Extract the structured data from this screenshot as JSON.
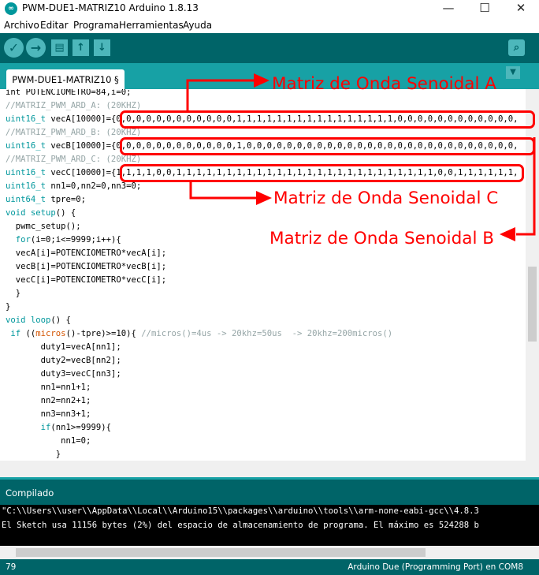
{
  "window": {
    "title": "PWM-DUE1-MATRIZ10 Arduino 1.8.13",
    "app_icon": "∞",
    "minimize": "—",
    "maximize": "☐",
    "close": "✕"
  },
  "menu": {
    "items": [
      "Archivo",
      "Editar",
      "Programa",
      "Herramientas",
      "Ayuda"
    ]
  },
  "toolbar": {
    "verify_icon": "✓",
    "upload_icon": "→",
    "new_icon": "▤",
    "open_icon": "↑",
    "save_icon": "↓",
    "serial_monitor_icon": "⌕"
  },
  "tab": {
    "label": "PWM-DUE1-MATRIZ10 §",
    "menu_icon": "▼"
  },
  "code": {
    "line1": "int POTENCIOMETRO=84,i=0;",
    "line2": "//MATRIZ_PWM_ARD_A: (20KHZ)",
    "line3a": "uint16_t",
    "line3b": " vecA[10000]={0,0,0,0,0,0,0,0,0,0,0,0,1,1,1,1,1,1,1,1,1,1,1,1,1,1,1,1,0,0,0,0,0,0,0,0,0,0,0,0,",
    "line4": "//MATRIZ_PWM_ARD_B: (20KHZ)",
    "line5a": "uint16_t",
    "line5b": " vecB[10000]={0,0,0,0,0,0,0,0,0,0,0,0,1,0,0,0,0,0,0,0,0,0,0,0,0,0,0,0,0,0,0,0,0,0,0,0,0,0,0,0,",
    "line6": "//MATRIZ_PWM_ARD_C: (20KHZ)",
    "line7a": "uint16_t",
    "line7b": " vecC[10000]={1,1,1,1,0,0,1,1,1,1,1,1,1,1,1,1,1,1,1,1,1,1,1,1,1,1,1,1,1,1,1,1,0,0,1,1,1,1,1,1,",
    "line8a": "uint16_t",
    "line8b": " nn1=0,nn2=0,nn3=0;",
    "line9a": "uint64_t",
    "line9b": " tpre=0;",
    "line10a": "void",
    "line10b": " ",
    "line10c": "setup",
    "line10d": "() {",
    "line11": "  pwmc_setup();",
    "line12a": "  ",
    "line12b": "for",
    "line12c": "(i=0;i<=9999;i++){",
    "line13": "  vecA[i]=POTENCIOMETRO*vecA[i];",
    "line14": "  vecB[i]=POTENCIOMETRO*vecB[i];",
    "line15": "  vecC[i]=POTENCIOMETRO*vecC[i];",
    "line16": "  }",
    "line17": "}",
    "line18a": "void",
    "line18b": " ",
    "line18c": "loop",
    "line18d": "() {",
    "line19a": " ",
    "line19b": "if",
    "line19c": " ((",
    "line19d": "micros",
    "line19e": "()-tpre)>=10){ ",
    "line19f": "//micros()=4us -> 20khz=50us  -> 20khz=200micros()",
    "line20": "       duty1=vecA[nn1];",
    "line21": "       duty2=vecB[nn2];",
    "line22": "       duty3=vecC[nn3];",
    "line23": "       nn1=nn1+1;",
    "line24": "       nn2=nn2+1;",
    "line25": "       nn3=nn3+1;",
    "line26a": "       ",
    "line26b": "if",
    "line26c": "(nn1>=9999){",
    "line27": "           nn1=0;",
    "line28": "          }"
  },
  "annotations": {
    "a": "Matriz de Onda Senoidal A",
    "b": "Matriz de Onda Senoidal B",
    "c": "Matriz de Onda Senoidal C",
    "color": "#ff0000"
  },
  "console": {
    "status": "Compilado",
    "line1": "\"C:\\\\Users\\\\user\\\\AppData\\\\Local\\\\Arduino15\\\\packages\\\\arduino\\\\tools\\\\arm-none-eabi-gcc\\\\4.8.3",
    "line2": "El Sketch usa 11156 bytes (2%) del espacio de almacenamiento de programa. El máximo es 524288 b"
  },
  "statusbar": {
    "line_number": "79",
    "board": "Arduino Due (Programming Port) en COM8"
  },
  "colors": {
    "teal_dark": "#006468",
    "teal_mid": "#17a1a5",
    "teal_light": "#4db7bb",
    "keyword": "#00979c",
    "comment": "#95a5a6",
    "function": "#d35400"
  }
}
